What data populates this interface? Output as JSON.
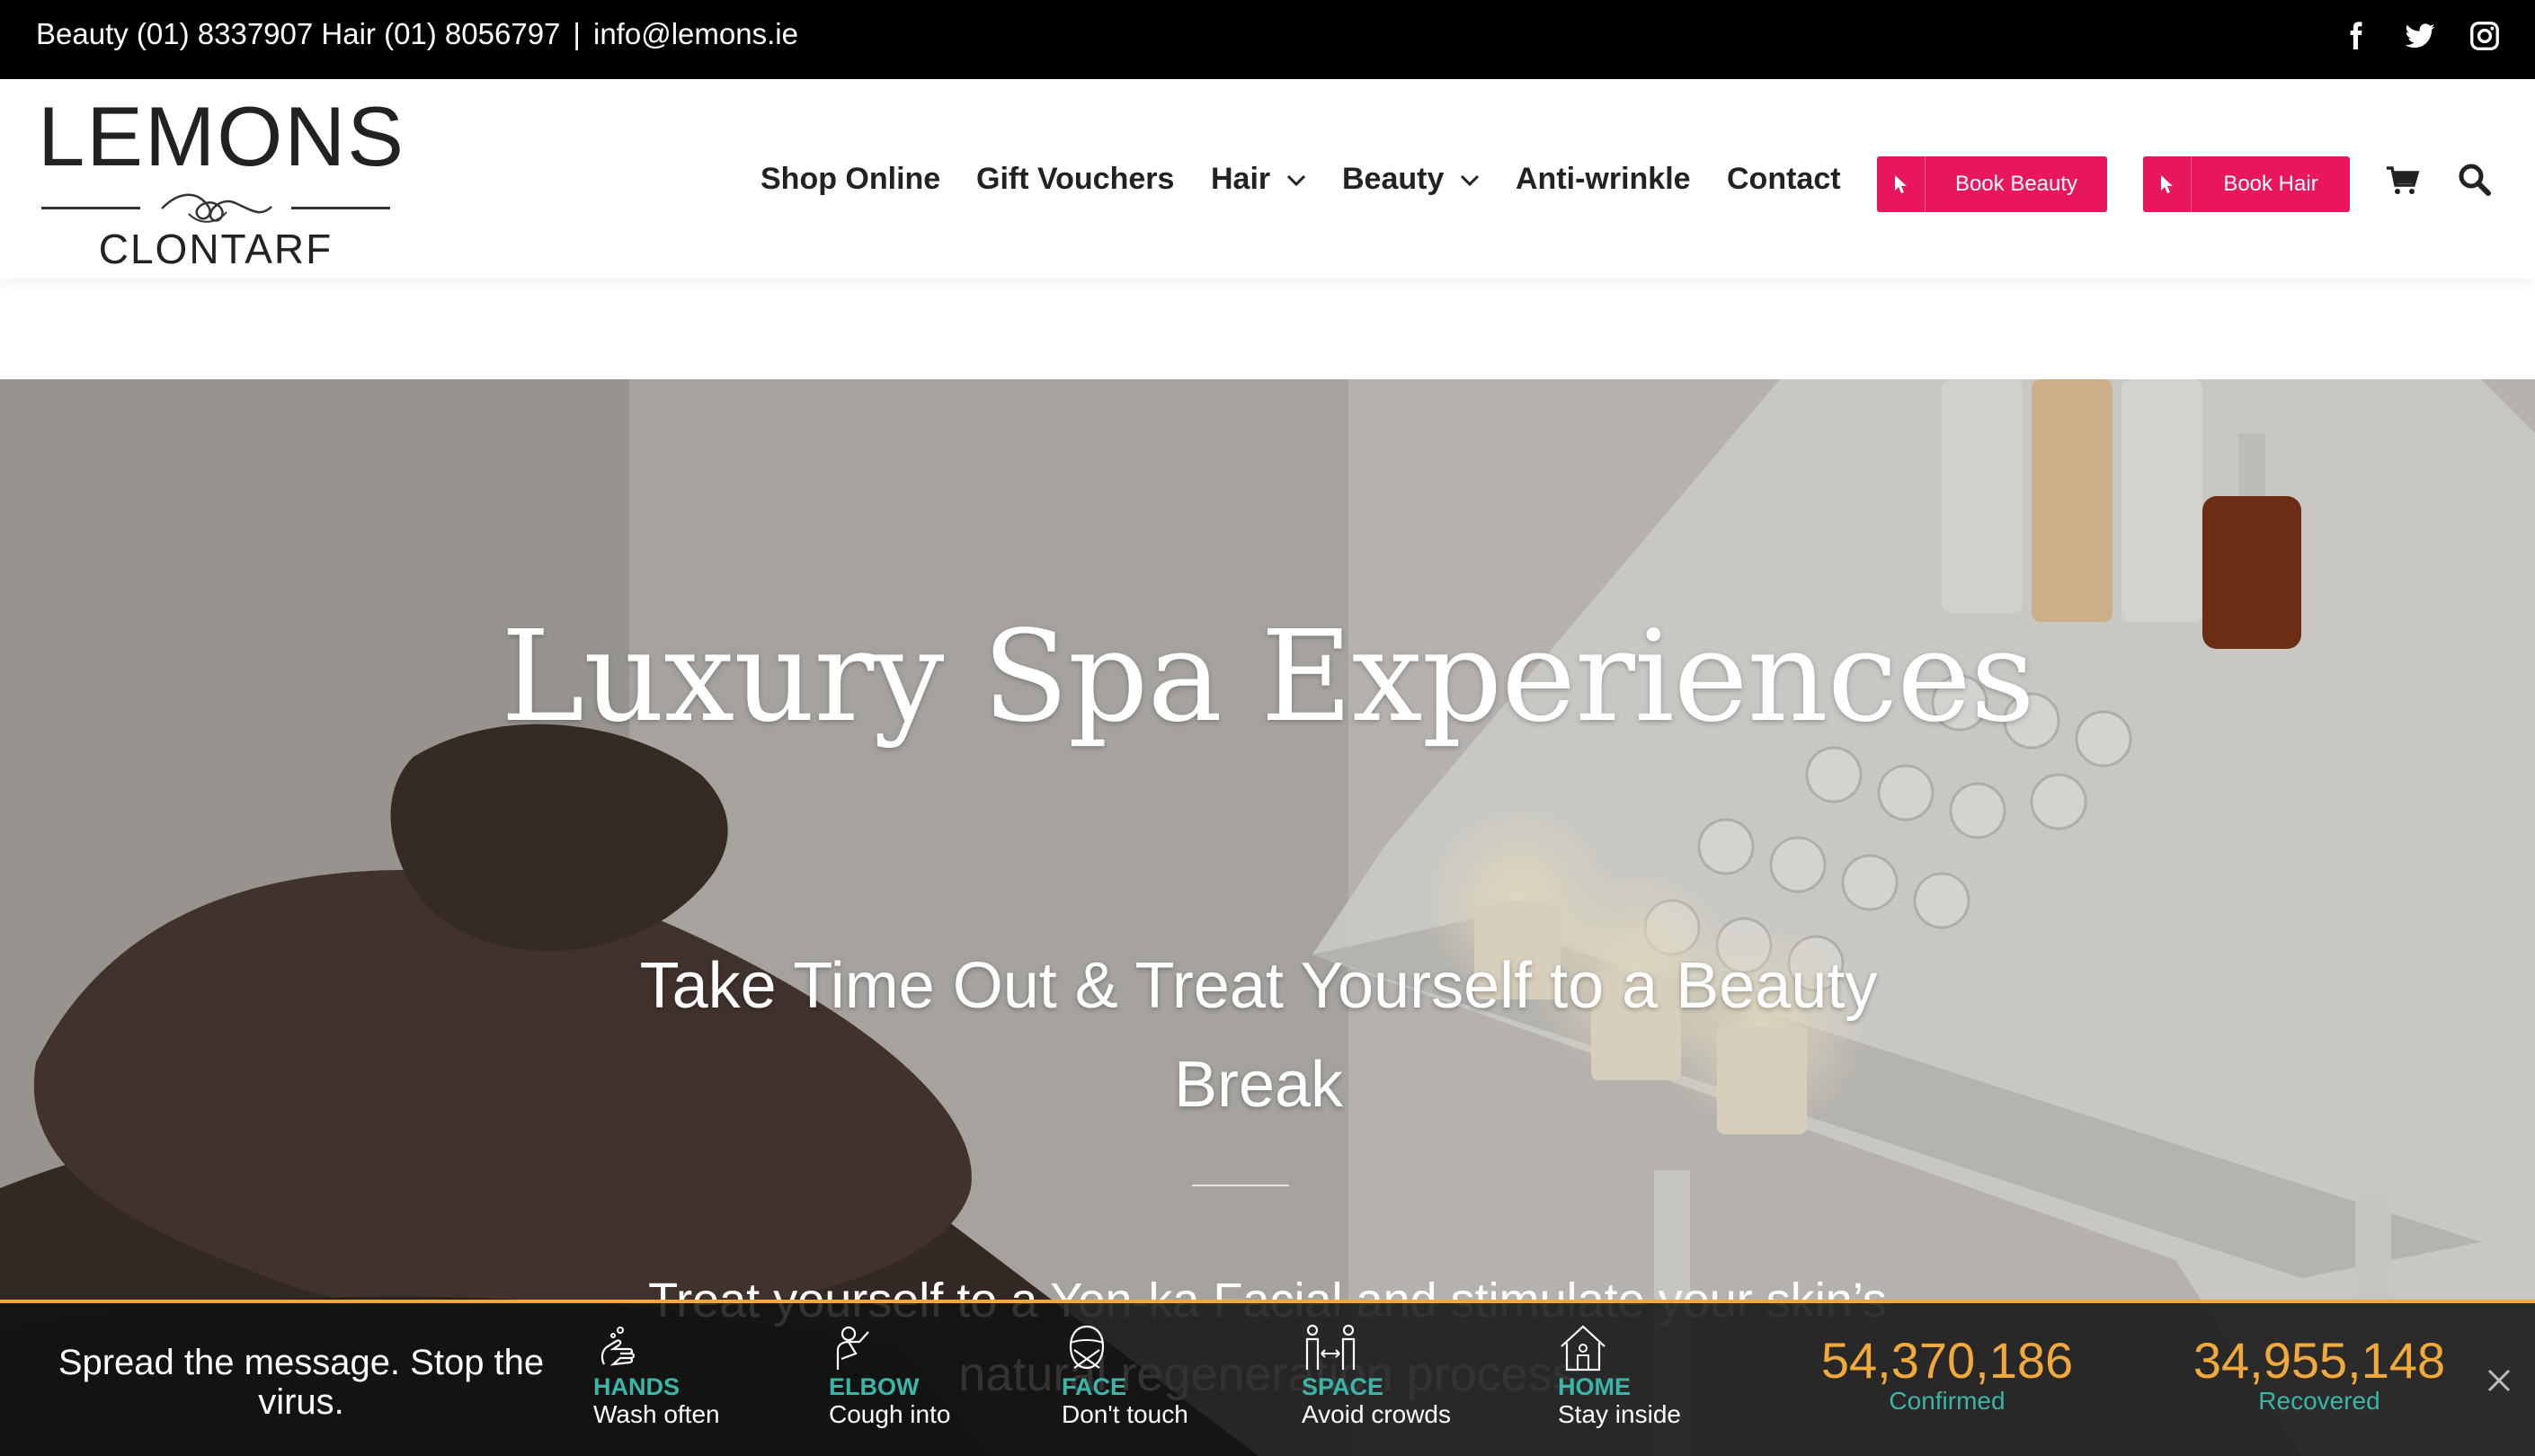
{
  "topbar": {
    "contact_text": "Beauty (01) 8337907 Hair (01) 8056797",
    "separator": "|",
    "email": "info@lemons.ie",
    "social": [
      "facebook-icon",
      "twitter-icon",
      "instagram-icon"
    ]
  },
  "logo": {
    "brand": "LEMONS",
    "town": "CLONTARF"
  },
  "nav": {
    "items": [
      {
        "label": "Shop Online"
      },
      {
        "label": "Gift Vouchers"
      },
      {
        "label": "Hair"
      },
      {
        "label": "Beauty"
      },
      {
        "label": "Anti-wrinkle"
      },
      {
        "label": "Contact"
      }
    ],
    "book_beauty": "Book Beauty",
    "book_hair": "Book Hair",
    "accent_color": "#e8175d"
  },
  "hero": {
    "title": "Luxury Spa Experiences",
    "subtitle": "Take Time Out & Treat Yourself to a Beauty Break",
    "body": "Treat yourself to a Yon-ka Facial and stimulate your skin’s natural regeneration process"
  },
  "covid": {
    "message": "Spread the message. Stop the virus.",
    "tips": [
      {
        "icon": "hands-icon",
        "title": "HANDS",
        "desc": "Wash often"
      },
      {
        "icon": "elbow-icon",
        "title": "ELBOW",
        "desc": "Cough into"
      },
      {
        "icon": "face-icon",
        "title": "FACE",
        "desc": "Don't touch"
      },
      {
        "icon": "space-icon",
        "title": "SPACE",
        "desc": "Avoid crowds"
      },
      {
        "icon": "home-icon",
        "title": "HOME",
        "desc": "Stay inside"
      }
    ],
    "stats": [
      {
        "value": "54,370,186",
        "label": "Confirmed"
      },
      {
        "value": "34,955,148",
        "label": "Recovered"
      }
    ],
    "accent_orange": "#f2a93b",
    "accent_teal": "#3ab5a8"
  }
}
